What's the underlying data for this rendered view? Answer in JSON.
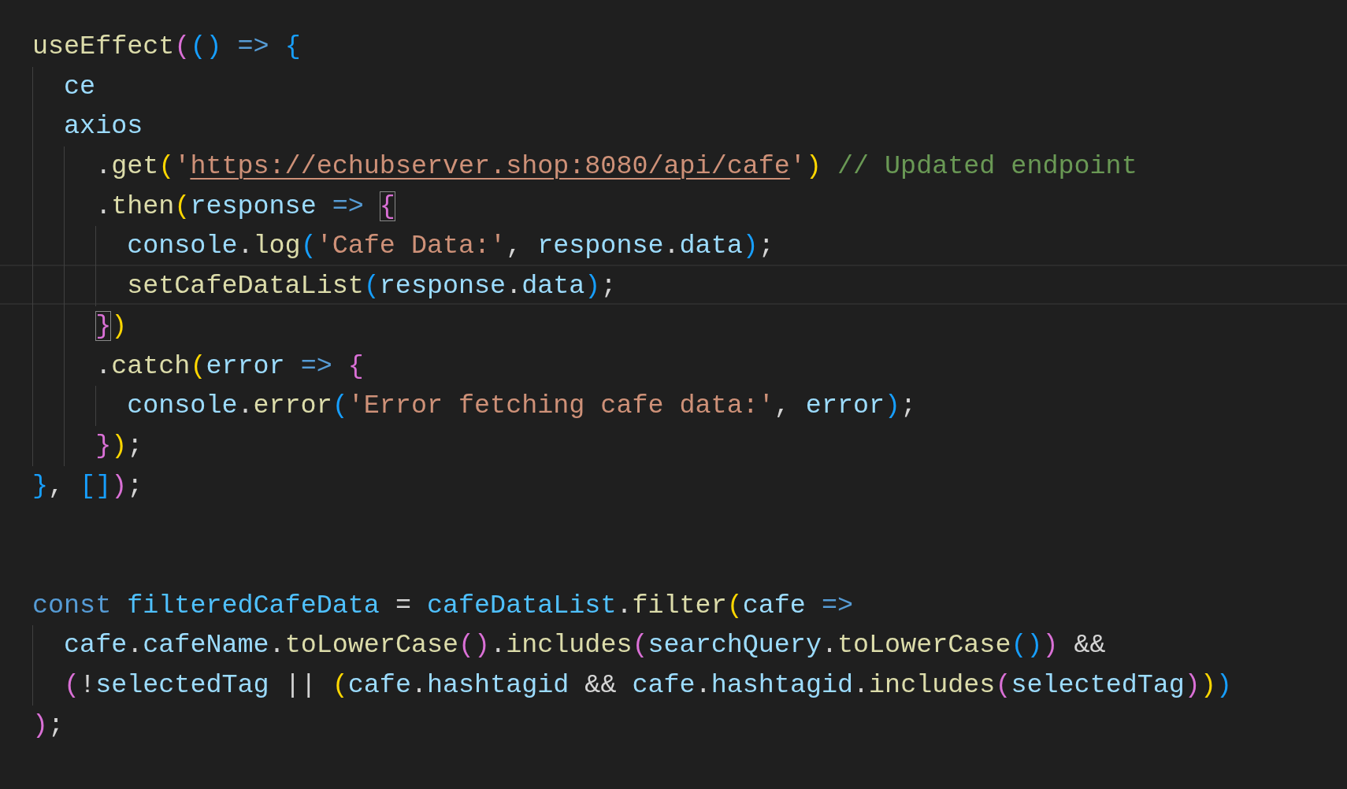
{
  "editor": {
    "lines": [
      {
        "kind": "code",
        "tokens": [
          {
            "t": "useEffect",
            "color": "#dcdcaa"
          },
          {
            "t": "(",
            "color": "#da70d6"
          },
          {
            "t": "() ",
            "color": "#179fff"
          },
          {
            "t": "=> ",
            "color": "#569cd6"
          },
          {
            "t": "{",
            "color": "#179fff"
          }
        ]
      },
      {
        "kind": "code",
        "tokens": [
          {
            "t": "  ce",
            "color": "#9cdcfe"
          }
        ]
      },
      {
        "kind": "code",
        "tokens": [
          {
            "t": "  axios",
            "color": "#9cdcfe"
          }
        ]
      },
      {
        "kind": "code",
        "tokens": [
          {
            "t": "    .",
            "color": "#d4d4d4"
          },
          {
            "t": "get",
            "color": "#dcdcaa"
          },
          {
            "t": "(",
            "color": "#ffd700"
          },
          {
            "t": "'",
            "color": "#ce9178"
          },
          {
            "t": "https://echubserver.shop:8080/api/cafe",
            "color": "#ce9178",
            "underlined": true
          },
          {
            "t": "'",
            "color": "#ce9178"
          },
          {
            "t": ") ",
            "color": "#ffd700"
          },
          {
            "t": "// Updated endpoint",
            "color": "#6a9955"
          }
        ]
      },
      {
        "kind": "code",
        "tokens": [
          {
            "t": "    .",
            "color": "#d4d4d4"
          },
          {
            "t": "then",
            "color": "#dcdcaa"
          },
          {
            "t": "(",
            "color": "#ffd700"
          },
          {
            "t": "response ",
            "color": "#9cdcfe"
          },
          {
            "t": "=> ",
            "color": "#569cd6"
          },
          {
            "t": "{",
            "color": "#da70d6",
            "matched": true
          }
        ]
      },
      {
        "kind": "code",
        "tokens": [
          {
            "t": "      console",
            "color": "#9cdcfe"
          },
          {
            "t": ".",
            "color": "#d4d4d4"
          },
          {
            "t": "log",
            "color": "#dcdcaa"
          },
          {
            "t": "(",
            "color": "#179fff"
          },
          {
            "t": "'Cafe Data:'",
            "color": "#ce9178"
          },
          {
            "t": ", ",
            "color": "#d4d4d4"
          },
          {
            "t": "response",
            "color": "#9cdcfe"
          },
          {
            "t": ".",
            "color": "#d4d4d4"
          },
          {
            "t": "data",
            "color": "#9cdcfe"
          },
          {
            "t": ")",
            "color": "#179fff"
          },
          {
            "t": ";",
            "color": "#d4d4d4"
          }
        ]
      },
      {
        "kind": "code",
        "current": true,
        "tokens": [
          {
            "t": "      setCafeDataList",
            "color": "#dcdcaa"
          },
          {
            "t": "(",
            "color": "#179fff"
          },
          {
            "t": "response",
            "color": "#9cdcfe"
          },
          {
            "t": ".",
            "color": "#d4d4d4"
          },
          {
            "t": "data",
            "color": "#9cdcfe"
          },
          {
            "t": ")",
            "color": "#179fff"
          },
          {
            "t": ";",
            "color": "#d4d4d4"
          }
        ]
      },
      {
        "kind": "code",
        "tokens": [
          {
            "t": "    }",
            "color": "#da70d6",
            "matched": true
          },
          {
            "t": ")",
            "color": "#ffd700"
          }
        ]
      },
      {
        "kind": "code",
        "tokens": [
          {
            "t": "    .",
            "color": "#d4d4d4"
          },
          {
            "t": "catch",
            "color": "#dcdcaa"
          },
          {
            "t": "(",
            "color": "#ffd700"
          },
          {
            "t": "error ",
            "color": "#9cdcfe"
          },
          {
            "t": "=> ",
            "color": "#569cd6"
          },
          {
            "t": "{",
            "color": "#da70d6"
          }
        ]
      },
      {
        "kind": "code",
        "tokens": [
          {
            "t": "      console",
            "color": "#9cdcfe"
          },
          {
            "t": ".",
            "color": "#d4d4d4"
          },
          {
            "t": "error",
            "color": "#dcdcaa"
          },
          {
            "t": "(",
            "color": "#179fff"
          },
          {
            "t": "'Error fetching cafe data:'",
            "color": "#ce9178"
          },
          {
            "t": ", ",
            "color": "#d4d4d4"
          },
          {
            "t": "error",
            "color": "#9cdcfe"
          },
          {
            "t": ")",
            "color": "#179fff"
          },
          {
            "t": ";",
            "color": "#d4d4d4"
          }
        ]
      },
      {
        "kind": "code",
        "tokens": [
          {
            "t": "    }",
            "color": "#da70d6"
          },
          {
            "t": ")",
            "color": "#ffd700"
          },
          {
            "t": ";",
            "color": "#d4d4d4"
          }
        ]
      },
      {
        "kind": "code",
        "tokens": [
          {
            "t": "}",
            "color": "#179fff"
          },
          {
            "t": ", ",
            "color": "#d4d4d4"
          },
          {
            "t": "[]",
            "color": "#179fff"
          },
          {
            "t": ")",
            "color": "#da70d6"
          },
          {
            "t": ";",
            "color": "#d4d4d4"
          }
        ]
      },
      {
        "kind": "blank"
      },
      {
        "kind": "blank"
      },
      {
        "kind": "code",
        "tokens": [
          {
            "t": "const ",
            "color": "#569cd6"
          },
          {
            "t": "filteredCafeData",
            "color": "#4fc1ff"
          },
          {
            "t": " = ",
            "color": "#d4d4d4"
          },
          {
            "t": "cafeDataList",
            "color": "#4fc1ff"
          },
          {
            "t": ".",
            "color": "#d4d4d4"
          },
          {
            "t": "filter",
            "color": "#dcdcaa"
          },
          {
            "t": "(",
            "color": "#ffd700"
          },
          {
            "t": "cafe ",
            "color": "#9cdcfe"
          },
          {
            "t": "=>",
            "color": "#569cd6"
          }
        ]
      },
      {
        "kind": "code",
        "tokens": [
          {
            "t": "  cafe",
            "color": "#9cdcfe"
          },
          {
            "t": ".",
            "color": "#d4d4d4"
          },
          {
            "t": "cafeName",
            "color": "#9cdcfe"
          },
          {
            "t": ".",
            "color": "#d4d4d4"
          },
          {
            "t": "toLowerCase",
            "color": "#dcdcaa"
          },
          {
            "t": "()",
            "color": "#da70d6"
          },
          {
            "t": ".",
            "color": "#d4d4d4"
          },
          {
            "t": "includes",
            "color": "#dcdcaa"
          },
          {
            "t": "(",
            "color": "#da70d6"
          },
          {
            "t": "searchQuery",
            "color": "#9cdcfe"
          },
          {
            "t": ".",
            "color": "#d4d4d4"
          },
          {
            "t": "toLowerCase",
            "color": "#dcdcaa"
          },
          {
            "t": "()",
            "color": "#179fff"
          },
          {
            "t": ")",
            "color": "#da70d6"
          },
          {
            "t": " &&",
            "color": "#d4d4d4"
          }
        ]
      },
      {
        "kind": "code",
        "tokens": [
          {
            "t": "  (",
            "color": "#da70d6"
          },
          {
            "t": "!",
            "color": "#d4d4d4"
          },
          {
            "t": "selectedTag",
            "color": "#9cdcfe"
          },
          {
            "t": " || ",
            "color": "#d4d4d4"
          },
          {
            "t": "(",
            "color": "#ffd700"
          },
          {
            "t": "cafe",
            "color": "#9cdcfe"
          },
          {
            "t": ".",
            "color": "#d4d4d4"
          },
          {
            "t": "hashtagid",
            "color": "#9cdcfe"
          },
          {
            "t": " && ",
            "color": "#d4d4d4"
          },
          {
            "t": "cafe",
            "color": "#9cdcfe"
          },
          {
            "t": ".",
            "color": "#d4d4d4"
          },
          {
            "t": "hashtagid",
            "color": "#9cdcfe"
          },
          {
            "t": ".",
            "color": "#d4d4d4"
          },
          {
            "t": "includes",
            "color": "#dcdcaa"
          },
          {
            "t": "(",
            "color": "#da70d6"
          },
          {
            "t": "selectedTag",
            "color": "#9cdcfe"
          },
          {
            "t": ")",
            "color": "#da70d6"
          },
          {
            "t": ")",
            "color": "#ffd700"
          },
          {
            "t": ")",
            "color": "#179fff"
          }
        ]
      },
      {
        "kind": "code",
        "tokens": [
          {
            "t": ")",
            "color": "#da70d6"
          },
          {
            "t": ";",
            "color": "#d4d4d4"
          }
        ]
      }
    ]
  }
}
